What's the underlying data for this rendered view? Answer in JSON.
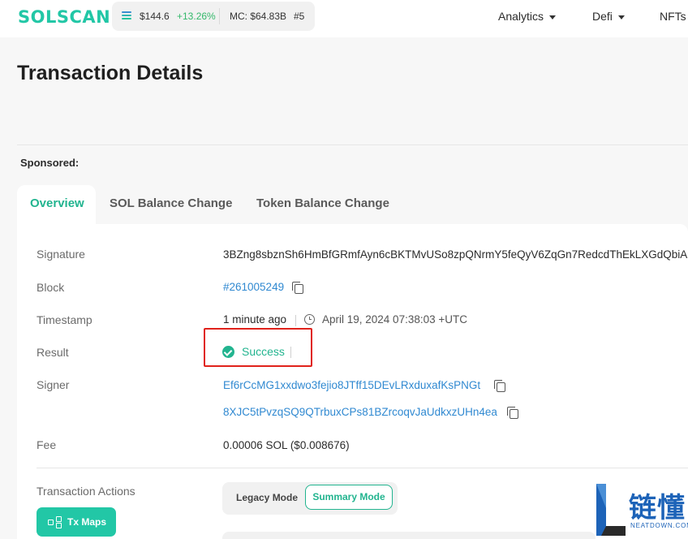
{
  "header": {
    "logo": "SOLSCAN",
    "price": "$144.6",
    "price_change": "+13.26%",
    "market_cap": "MC: $64.83B",
    "rank": "#5",
    "nav": [
      {
        "label": "Analytics"
      },
      {
        "label": "Defi"
      },
      {
        "label": "NFTs"
      }
    ]
  },
  "page_title": "Transaction Details",
  "sponsored": "Sponsored:",
  "tabs": [
    {
      "label": "Overview",
      "active": true
    },
    {
      "label": "SOL Balance Change"
    },
    {
      "label": "Token Balance Change"
    }
  ],
  "details": {
    "signature_label": "Signature",
    "signature": "3BZng8sbznSh6HmBfGRmfAyn6cBKTMvUSo8zpQNrmY5feQyV6ZqGn7RedcdThEkLXGdQbiA",
    "block_label": "Block",
    "block": "#261005249",
    "timestamp_label": "Timestamp",
    "timestamp_relative": "1 minute ago",
    "timestamp_absolute": "April 19, 2024 07:38:03 +UTC",
    "result_label": "Result",
    "result": "Success",
    "signer_label": "Signer",
    "signers": [
      "Ef6rCcMG1xxdwo3fejio8JTff15DEvLRxduxafKsPNGt",
      "8XJC5tPvzqSQ9QTrbuxCPs81BZrcoqvJaUdkxzUHn4ea"
    ],
    "fee_label": "Fee",
    "fee": "0.00006 SOL ($0.008676)"
  },
  "actions": {
    "label": "Transaction Actions",
    "legacy_mode": "Legacy Mode",
    "summary_mode": "Summary Mode",
    "tx_maps": "Tx Maps"
  },
  "watermark": {
    "text": "链懂",
    "sub": "NEATDOWN.COM"
  },
  "colors": {
    "accent": "#22b48f",
    "link": "#3089d1",
    "highlight_border": "#e0221b"
  }
}
